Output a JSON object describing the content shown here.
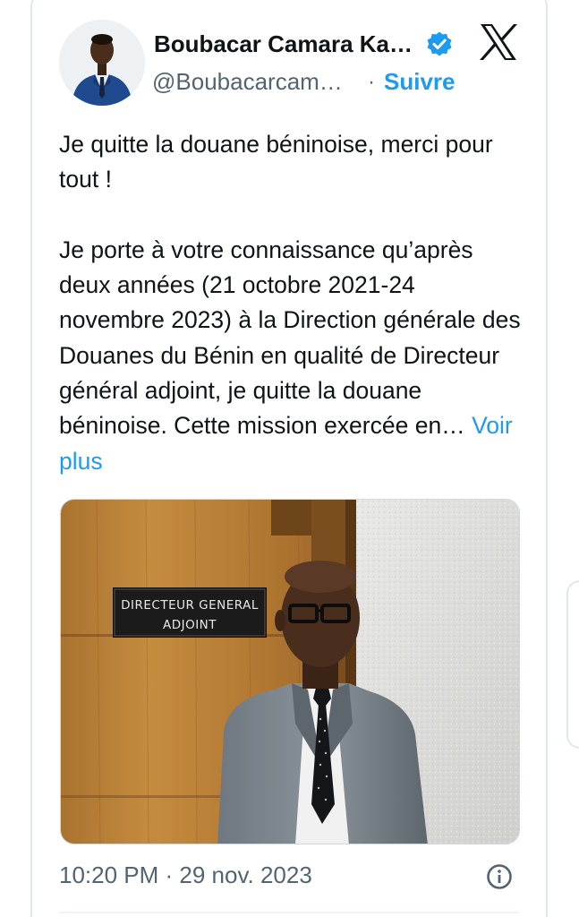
{
  "tweet": {
    "author_name": "Boubacar Camara Ka…",
    "handle": "@Boubacarcam…",
    "separator": "·",
    "follow_label": "Suivre",
    "text_line1": "Je quitte la douane béninoise, merci pour tout !",
    "text_body": "Je porte à votre connaissance qu’après deux années (21 octobre 2021-24 novembre 2023) à la Direction générale des Douanes du Bénin en qualité de Directeur général adjoint, je quitte la douane béninoise. Cette mission exercée en…",
    "see_more_label": "Voir plus",
    "timestamp": "10:20 PM · 29 nov. 2023"
  },
  "photo": {
    "sign_line1": "DIRECTEUR GENERAL",
    "sign_line2": "ADJOINT"
  },
  "icons": {
    "verified": "verified-badge-icon",
    "brand": "x-logo-icon",
    "info": "info-icon"
  },
  "colors": {
    "accent": "#1d9bf0",
    "text": "#0f1419",
    "muted": "#536471",
    "border": "#e1e8ed"
  }
}
